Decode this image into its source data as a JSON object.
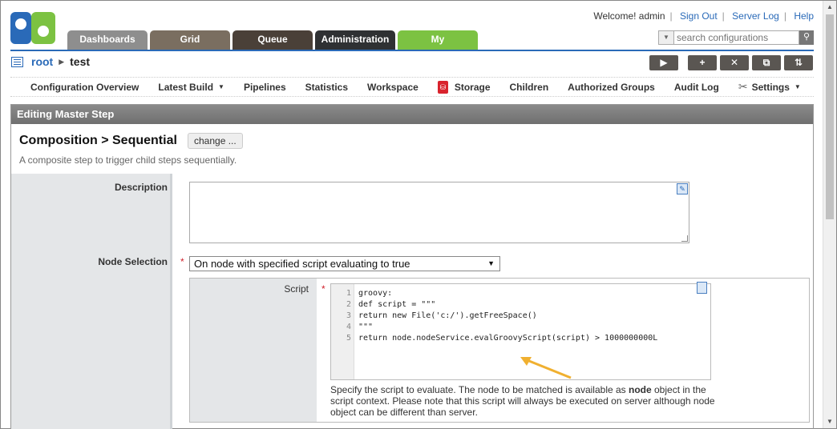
{
  "header": {
    "welcome": "Welcome! admin",
    "links": [
      "Sign Out",
      "Server Log",
      "Help"
    ],
    "search_placeholder": "search configurations"
  },
  "tabs": [
    "Dashboards",
    "Grid",
    "Queue",
    "Administration",
    "My"
  ],
  "breadcrumb": {
    "root": "root",
    "leaf": "test"
  },
  "menu": {
    "items": [
      "Configuration Overview",
      "Latest Build",
      "Pipelines",
      "Statistics",
      "Workspace",
      "Storage",
      "Children",
      "Authorized Groups",
      "Audit Log",
      "Settings"
    ]
  },
  "panel": {
    "header": "Editing Master Step",
    "title": "Composition > Sequential",
    "change_label": "change ...",
    "description": "A composite step to trigger child steps sequentially."
  },
  "form": {
    "description_label": "Description",
    "node_selection_label": "Node Selection",
    "node_selection_value": "On node with specified script evaluating to true",
    "script_label": "Script",
    "code_lines": [
      {
        "num": "1",
        "text": "groovy:"
      },
      {
        "num": "2",
        "text": "def script = \"\"\""
      },
      {
        "num": "3",
        "text": "return new File('c:/').getFreeSpace()"
      },
      {
        "num": "4",
        "text": "\"\"\""
      },
      {
        "num": "5",
        "text": "return node.nodeService.evalGroovyScript(script) > 1000000000L"
      }
    ],
    "help_prefix": "Specify the script to evaluate. The node to be matched is available as ",
    "help_bold": "node",
    "help_suffix": " object in the script context. Please note that this script will always be executed on server although node object can be different than server."
  },
  "colors": {
    "accent": "#2a6ab8",
    "my_tab": "#7cc242",
    "arrow": "#f0b030"
  }
}
